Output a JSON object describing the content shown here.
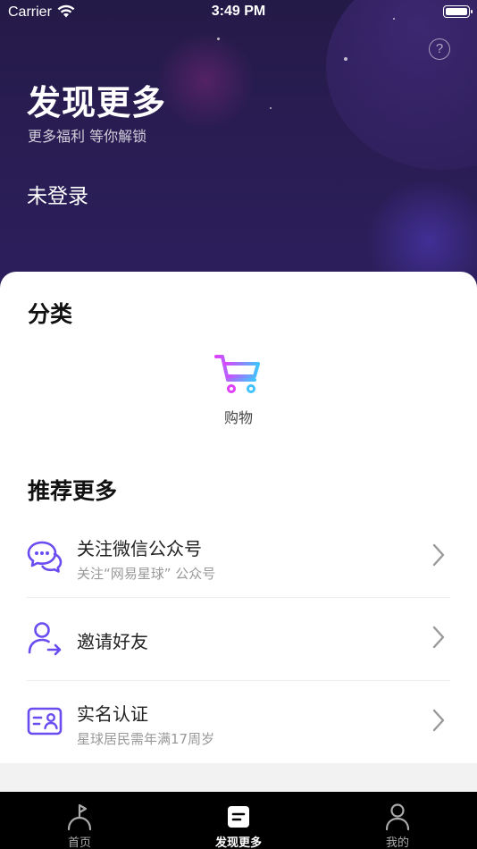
{
  "status": {
    "carrier": "Carrier",
    "time": "3:49 PM"
  },
  "header": {
    "title": "发现更多",
    "subtitle": "更多福利 等你解锁",
    "login_status": "未登录",
    "help_glyph": "?"
  },
  "categories": {
    "title": "分类",
    "items": [
      {
        "label": "购物",
        "icon": "shopping-cart-icon"
      }
    ]
  },
  "recommend": {
    "title": "推荐更多",
    "items": [
      {
        "title": "关注微信公众号",
        "subtitle": "关注“网易星球” 公众号",
        "icon": "wechat-chat-icon"
      },
      {
        "title": "邀请好友",
        "subtitle": "",
        "icon": "invite-user-icon"
      },
      {
        "title": "实名认证",
        "subtitle": "星球居民需年满17周岁",
        "icon": "id-card-icon"
      }
    ]
  },
  "tabbar": {
    "items": [
      {
        "label": "首页",
        "icon": "planet-flag-icon",
        "active": false
      },
      {
        "label": "发现更多",
        "icon": "discover-icon",
        "active": true
      },
      {
        "label": "我的",
        "icon": "profile-icon",
        "active": false
      }
    ]
  },
  "colors": {
    "header_bg": "#2a1d55",
    "accent_purple": "#6a4cf0",
    "cart_gradient_start": "#e040fb",
    "cart_gradient_end": "#40c4ff"
  }
}
